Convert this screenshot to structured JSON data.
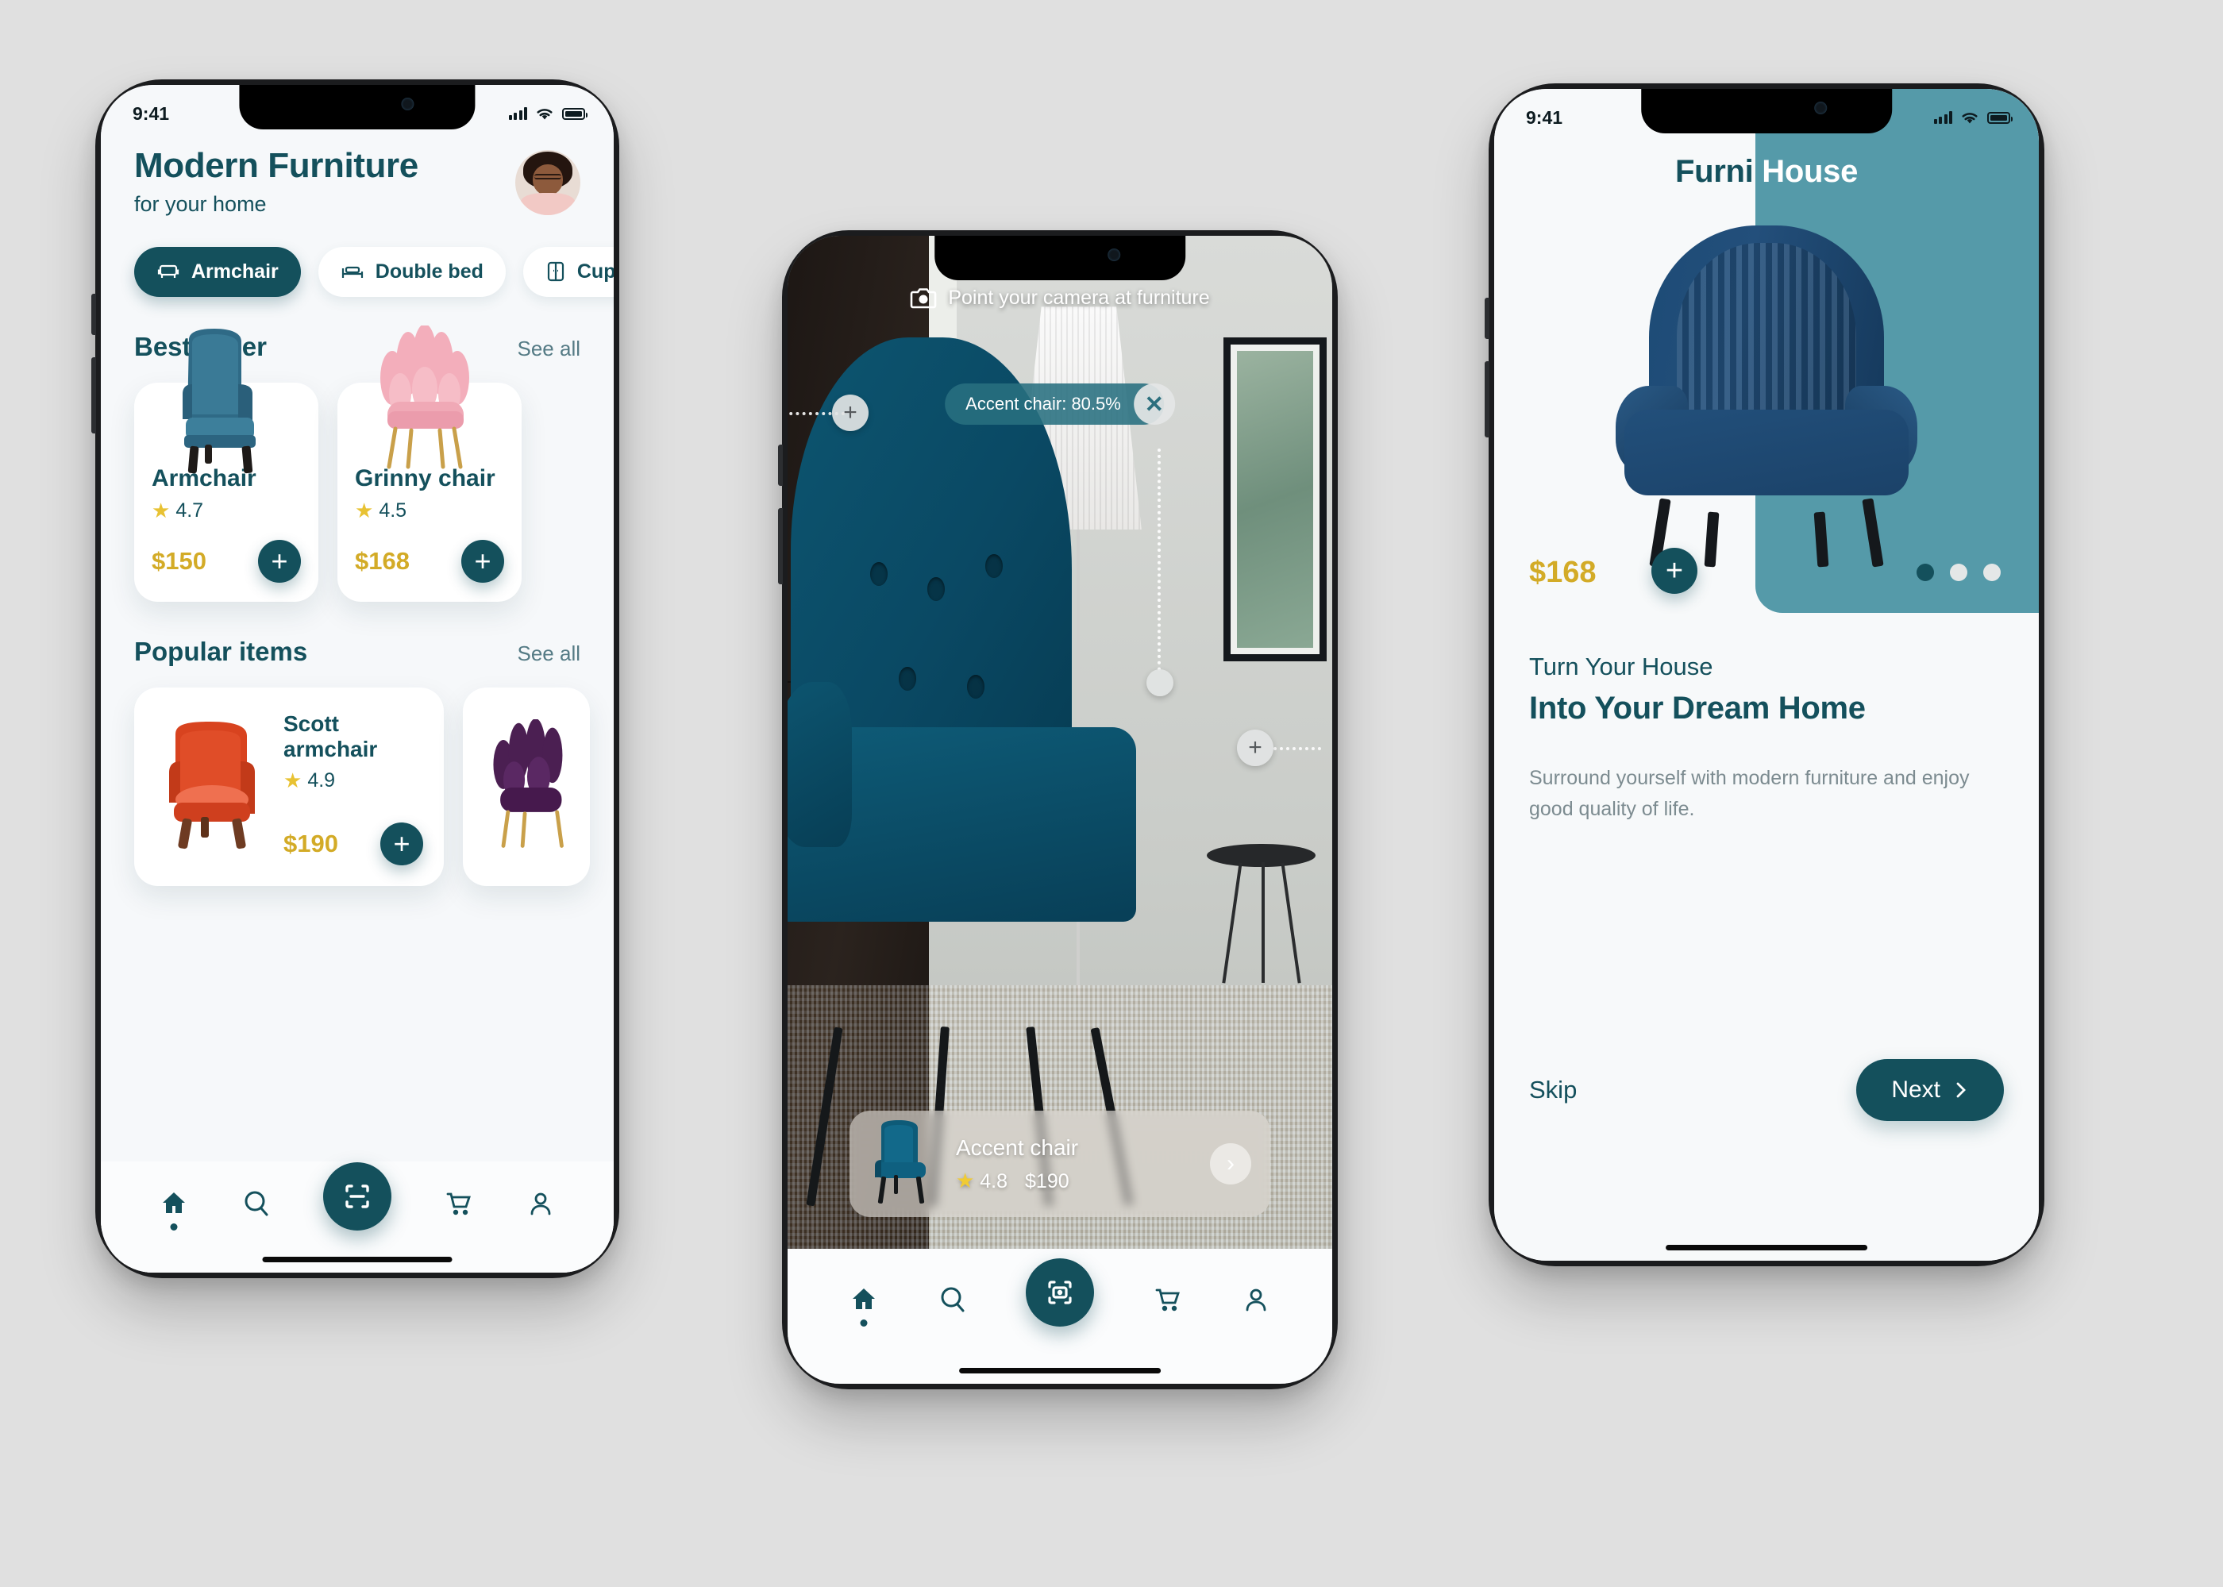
{
  "statusbar": {
    "time": "9:41",
    "signal_icon": "cellular-bars-icon",
    "wifi_icon": "wifi-icon",
    "battery_icon": "battery-icon"
  },
  "home": {
    "title": "Modern Furniture",
    "subtitle": "for your home",
    "avatar_name": "user-avatar",
    "categories": [
      {
        "label": "Armchair",
        "icon": "armchair-icon",
        "active": true
      },
      {
        "label": "Double bed",
        "icon": "bed-icon",
        "active": false
      },
      {
        "label": "Cupboard",
        "icon": "cupboard-icon",
        "active": false
      }
    ],
    "best_seller": {
      "title": "Best seller",
      "see_all": "See all",
      "items": [
        {
          "name": "Armchair",
          "rating": "4.7",
          "price": "$150",
          "add_label": "+",
          "color": "#2e6b86"
        },
        {
          "name": "Grinny chair",
          "rating": "4.5",
          "price": "$168",
          "add_label": "+",
          "color": "#f0b0bb"
        }
      ]
    },
    "popular": {
      "title": "Popular items",
      "see_all": "See all",
      "items": [
        {
          "name": "Scott armchair",
          "rating": "4.9",
          "price": "$190",
          "add_label": "+",
          "color": "#d8431f"
        },
        {
          "name": "",
          "rating": "",
          "price": "",
          "add_label": "",
          "color": "#4b1f52"
        }
      ]
    },
    "nav": [
      {
        "icon": "home-icon",
        "active": true
      },
      {
        "icon": "search-icon",
        "active": false
      },
      {
        "icon": "scan-icon",
        "active": false
      },
      {
        "icon": "cart-icon",
        "active": false
      },
      {
        "icon": "profile-icon",
        "active": false
      }
    ]
  },
  "ar": {
    "hint": "Point your camera at furniture",
    "hint_icon": "camera-icon",
    "detection": {
      "label": "Accent chair: 80.5%",
      "close_label": "✕"
    },
    "handles": {
      "plus": "+"
    },
    "card": {
      "name": "Accent chair",
      "rating": "4.8",
      "price": "$190",
      "next_label": "›",
      "thumb": "accent-chair-thumb"
    },
    "nav": [
      {
        "icon": "home-icon",
        "active": true
      },
      {
        "icon": "search-icon",
        "active": false
      },
      {
        "icon": "camera-scan-icon",
        "active": false
      },
      {
        "icon": "cart-icon",
        "active": false
      },
      {
        "icon": "profile-icon",
        "active": false
      }
    ]
  },
  "onboarding": {
    "brand_first": "Furni",
    "brand_second": "House",
    "price": "$168",
    "add_label": "+",
    "dots": [
      true,
      false,
      false
    ],
    "kicker": "Turn Your House",
    "headline": "Into Your Dream Home",
    "paragraph": "Surround yourself with modern furniture and enjoy good quality of life.",
    "skip_label": "Skip",
    "next_label": "Next",
    "next_icon": "chevron-right-icon"
  },
  "colors": {
    "dark_teal": "#14505c",
    "teal_panel": "#559aa9",
    "gold": "#d3ab27",
    "page_bg": "#e0e0e0",
    "screen_bg": "#f6f8fa"
  }
}
